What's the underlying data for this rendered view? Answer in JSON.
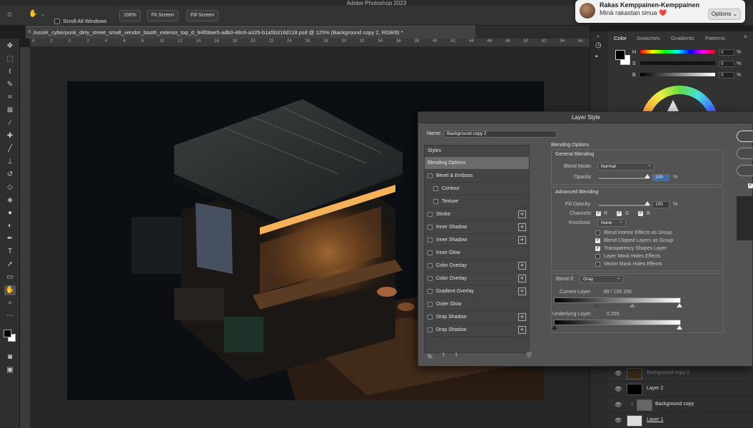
{
  "app": {
    "title": "Adobe Photoshop 2023"
  },
  "notification": {
    "sender": "Rakas Kemppainen-Kemppainen",
    "message": "Minä rakastan sinua ❤️",
    "options_label": "Options ⌄"
  },
  "options_bar": {
    "scroll_all_windows": "Scroll All Windows",
    "zoom_100": "100%",
    "fit_screen": "Fit Screen",
    "fill_screen": "Fill Screen"
  },
  "document": {
    "tab_title": "JussiK_cyberpunk_dirty_street_small_vendor_booth_exterior_top_d_94f08ae5-adb0-48c6-a325-b1a5b316d118.psd @ 125% (Background copy 2, RGB/8) *"
  },
  "ruler_ticks": [
    "4",
    "2",
    "0",
    "2",
    "4",
    "6",
    "8",
    "10",
    "12",
    "14",
    "16",
    "18",
    "20",
    "22",
    "24",
    "26",
    "28",
    "30",
    "32",
    "34",
    "36",
    "38",
    "40",
    "42",
    "44",
    "46",
    "48",
    "50",
    "52",
    "54",
    "56"
  ],
  "tools": [
    "move-icon",
    "marquee-icon",
    "lasso-icon",
    "quick-select-icon",
    "crop-icon",
    "frame-icon",
    "eyedropper-icon",
    "healing-icon",
    "brush-icon",
    "stamp-icon",
    "history-brush-icon",
    "eraser-icon",
    "gradient-icon",
    "blur-icon",
    "dodge-icon",
    "pen-icon",
    "type-icon",
    "path-select-icon",
    "shape-icon",
    "hand-icon",
    "zoom-icon",
    "more-icon"
  ],
  "color_panel": {
    "tabs": [
      "Color",
      "Swatches",
      "Gradients",
      "Patterns"
    ],
    "h_label": "H",
    "s_label": "S",
    "b_label": "B",
    "h_value": "0",
    "s_value": "0",
    "b_value": "0",
    "pct": "%"
  },
  "layers": [
    {
      "name": "Background copy 2"
    },
    {
      "name": "Layer 2"
    },
    {
      "name": "Background copy"
    },
    {
      "name": "Layer 1"
    }
  ],
  "dialog": {
    "title": "Layer Style",
    "name_label": "Name:",
    "name_value": "Background copy 2",
    "styles_header": "Styles",
    "styles": [
      {
        "label": "Blending Options",
        "checkbox": false,
        "plus": false,
        "selected": true,
        "indent": false
      },
      {
        "label": "Bevel & Emboss",
        "checkbox": true,
        "plus": false,
        "selected": false,
        "indent": false
      },
      {
        "label": "Contour",
        "checkbox": true,
        "plus": false,
        "selected": false,
        "indent": true
      },
      {
        "label": "Texture",
        "checkbox": true,
        "plus": false,
        "selected": false,
        "indent": true
      },
      {
        "label": "Stroke",
        "checkbox": true,
        "plus": true,
        "selected": false,
        "indent": false
      },
      {
        "label": "Inner Shadow",
        "checkbox": true,
        "plus": true,
        "selected": false,
        "indent": false
      },
      {
        "label": "Inner Shadow",
        "checkbox": true,
        "plus": true,
        "selected": false,
        "indent": false
      },
      {
        "label": "Inner Glow",
        "checkbox": true,
        "plus": false,
        "selected": false,
        "indent": false
      },
      {
        "label": "Color Overlay",
        "checkbox": true,
        "plus": true,
        "selected": false,
        "indent": false
      },
      {
        "label": "Color Overlay",
        "checkbox": true,
        "plus": true,
        "selected": false,
        "indent": false
      },
      {
        "label": "Gradient Overlay",
        "checkbox": true,
        "plus": true,
        "selected": false,
        "indent": false
      },
      {
        "label": "Outer Glow",
        "checkbox": true,
        "plus": false,
        "selected": false,
        "indent": false
      },
      {
        "label": "Drop Shadow",
        "checkbox": true,
        "plus": true,
        "selected": false,
        "indent": false
      },
      {
        "label": "Drop Shadow",
        "checkbox": true,
        "plus": true,
        "selected": false,
        "indent": false
      }
    ],
    "fx_label": "fx.",
    "blending_options_title": "Blending Options",
    "general_blending": "General Blending",
    "blend_mode_label": "Blend Mode:",
    "blend_mode_value": "Normal",
    "opacity_label": "Opacity:",
    "opacity_value": "100",
    "pct": "%",
    "advanced_blending": "Advanced Blending",
    "fill_opacity_label": "Fill Opacity:",
    "fill_opacity_value": "100",
    "channels_label": "Channels:",
    "channel_r": "R",
    "channel_g": "G",
    "channel_b": "B",
    "knockout_label": "Knockout:",
    "knockout_value": "None",
    "opt_blend_interior": "Blend Interior Effects as Group",
    "opt_blend_clipped": "Blend Clipped Layers as Group",
    "opt_transparency": "Transparency Shapes Layer",
    "opt_layer_mask": "Layer Mask Hides Effects",
    "opt_vector_mask": "Vector Mask Hides Effects",
    "blend_if_label": "Blend If:",
    "blend_if_value": "Gray",
    "current_layer_label": "Current Layer:",
    "current_values": "89  /  156      255",
    "underlying_layer_label": "Underlying Layer:",
    "underlying_values": "0                   255"
  },
  "colors": {
    "accent": "#e8a050",
    "dialog_bg": "#535353"
  }
}
